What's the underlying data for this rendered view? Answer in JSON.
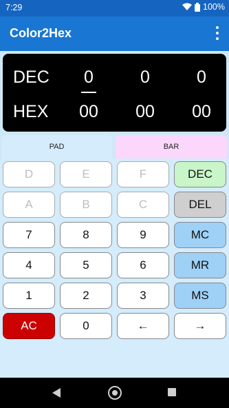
{
  "status": {
    "time": "7:29",
    "battery": "100%"
  },
  "app": {
    "title": "Color2Hex"
  },
  "display": {
    "dec_label": "DEC",
    "hex_label": "HEX",
    "dec_values": [
      "0",
      "0",
      "0"
    ],
    "hex_values": [
      "00",
      "00",
      "00"
    ]
  },
  "tabs": {
    "pad": "PAD",
    "bar": "BAR"
  },
  "keys": {
    "d": "D",
    "e": "E",
    "f": "F",
    "dec": "DEC",
    "a": "A",
    "b": "B",
    "c": "C",
    "del": "DEL",
    "k7": "7",
    "k8": "8",
    "k9": "9",
    "mc": "MC",
    "k4": "4",
    "k5": "5",
    "k6": "6",
    "mr": "MR",
    "k1": "1",
    "k2": "2",
    "k3": "3",
    "ms": "MS",
    "ac": "AC",
    "k0": "0",
    "left": "←",
    "right": "→"
  },
  "colors": {
    "primary": "#1976d2",
    "status_bar": "#1565c0",
    "dec_key": "#c9f5c9",
    "del_key": "#cfcfcf",
    "memory_key": "#9fd0f5",
    "ac_key": "#cc0000",
    "pad_tab": "#d4ecfb",
    "bar_tab": "#fbd7fb"
  },
  "icons": [
    "wifi-icon",
    "battery-icon",
    "overflow-menu-icon",
    "nav-back-icon",
    "nav-home-icon",
    "nav-recents-icon"
  ]
}
